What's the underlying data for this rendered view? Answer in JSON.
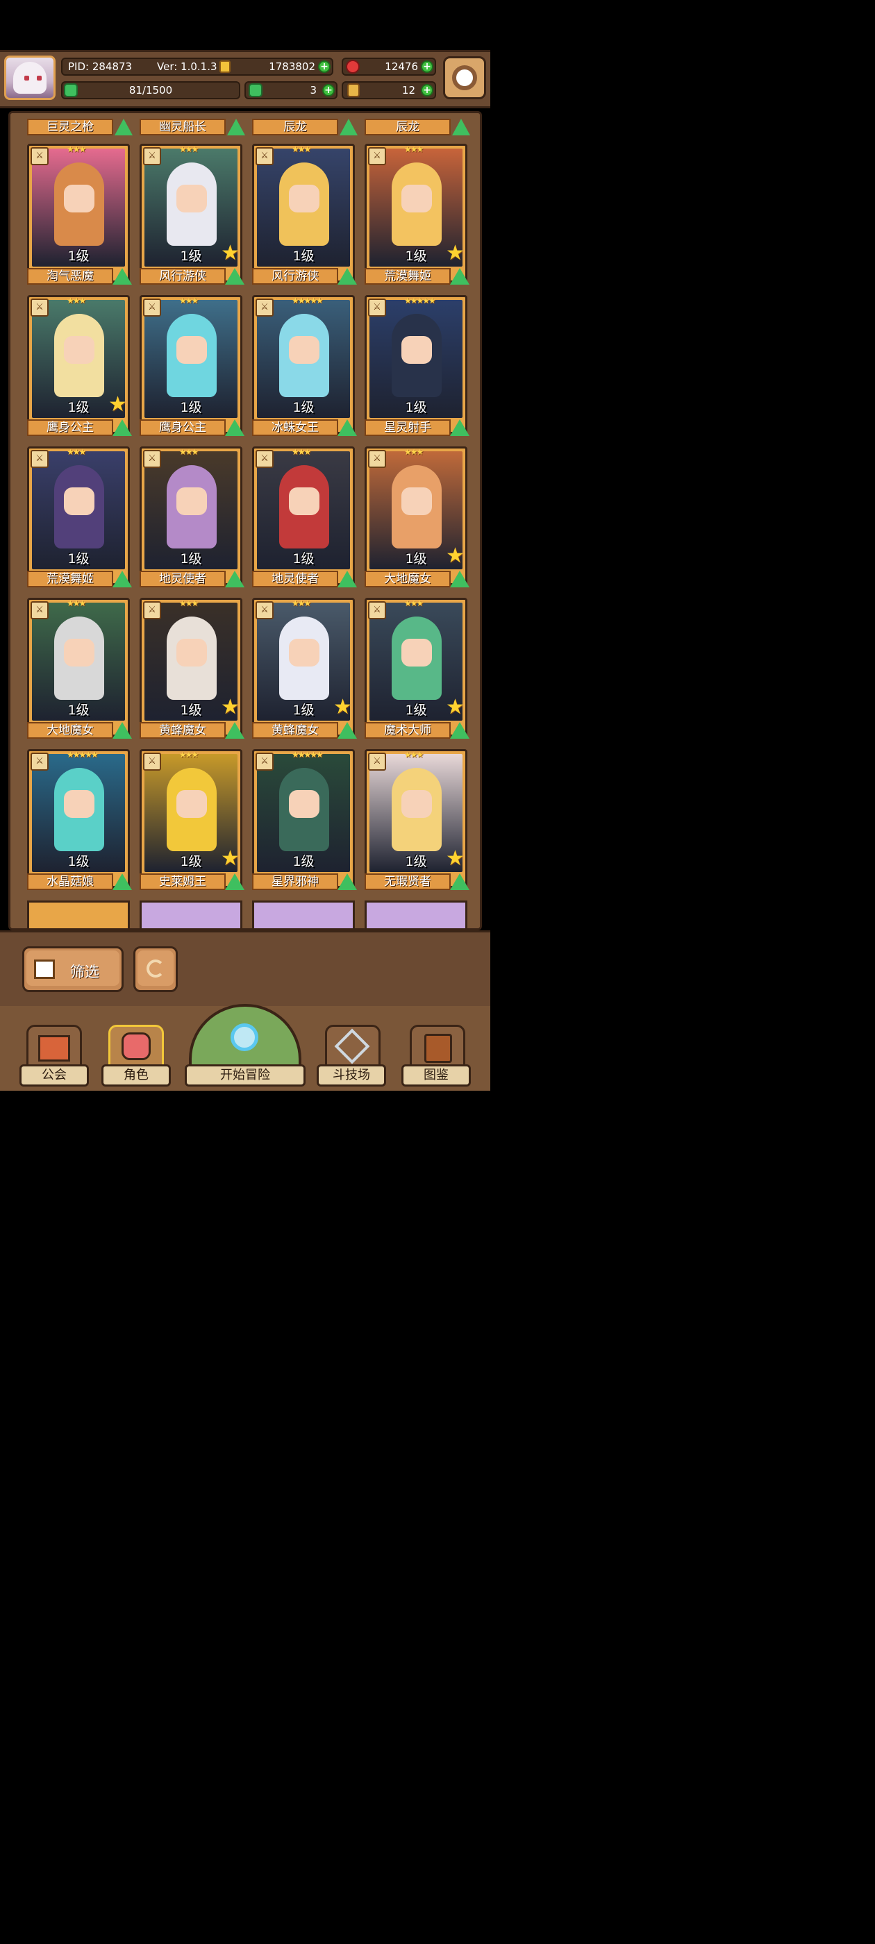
{
  "header": {
    "pid": "PID: 284873",
    "version": "Ver: 1.0.1.3",
    "gold": "1783802",
    "gems": "12476",
    "exp": "81/1500",
    "clover": "3",
    "ticket": "12"
  },
  "top_names": [
    "巨灵之枪",
    "幽灵船长",
    "辰龙",
    "辰龙"
  ],
  "cards": [
    {
      "name": "淘气恶魔",
      "level": "1级",
      "art": "#e56b8f",
      "hair": "#d98a4a",
      "stars": "★★★"
    },
    {
      "name": "风行游侠",
      "level": "1级",
      "art": "#4b7a6a",
      "hair": "#e8e8f0",
      "stars": "★★★"
    },
    {
      "name": "风行游侠",
      "level": "1级",
      "art": "#36446a",
      "hair": "#f0c25a",
      "stars": "★★★"
    },
    {
      "name": "荒漠舞姬",
      "level": "1级",
      "art": "#c8643a",
      "hair": "#f3c360",
      "stars": "★★★"
    },
    {
      "name": "鹰身公主",
      "level": "1级",
      "art": "#4a7a6a",
      "hair": "#f2dfa0",
      "stars": "★★★"
    },
    {
      "name": "鹰身公主",
      "level": "1级",
      "art": "#3f6f8a",
      "hair": "#6fd6e0",
      "stars": "★★★"
    },
    {
      "name": "冰蛛女王",
      "level": "1级",
      "art": "#3a5f7a",
      "hair": "#8ad9e8",
      "stars": "★★★★★"
    },
    {
      "name": "星灵射手",
      "level": "1级",
      "art": "#2c3f6a",
      "hair": "#28324a",
      "stars": "★★★★★"
    },
    {
      "name": "荒漠舞姬",
      "level": "1级",
      "art": "#3a3f6a",
      "hair": "#52407a",
      "stars": "★★★"
    },
    {
      "name": "地灵使者",
      "level": "1级",
      "art": "#4a3a2a",
      "hair": "#b48ac8",
      "stars": "★★★"
    },
    {
      "name": "地灵使者",
      "level": "1级",
      "art": "#3a3a44",
      "hair": "#c23a3a",
      "stars": "★★★"
    },
    {
      "name": "大地魔女",
      "level": "1级",
      "art": "#c06a3a",
      "hair": "#e8a068",
      "stars": "★★★"
    },
    {
      "name": "大地魔女",
      "level": "1级",
      "art": "#3f6a4a",
      "hair": "#d8d8d8",
      "stars": "★★★"
    },
    {
      "name": "黄蜂魔女",
      "level": "1级",
      "art": "#3a3028",
      "hair": "#e8e0d8",
      "stars": "★★★"
    },
    {
      "name": "黄蜂魔女",
      "level": "1级",
      "art": "#4a5a6a",
      "hair": "#e8eaf4",
      "stars": "★★★"
    },
    {
      "name": "魔术大师",
      "level": "1级",
      "art": "#3a4a5a",
      "hair": "#58b888",
      "stars": "★★★"
    },
    {
      "name": "水晶菇娘",
      "level": "1级",
      "art": "#2a6a8a",
      "hair": "#5ad0c8",
      "stars": "★★★★★"
    },
    {
      "name": "史莱姆王",
      "level": "1级",
      "art": "#c89a2a",
      "hair": "#f2c83a",
      "stars": "★★★"
    },
    {
      "name": "星界邪神",
      "level": "1级",
      "art": "#2a4a3a",
      "hair": "#3a6a5a",
      "stars": "★★★★★"
    },
    {
      "name": "无瑕贤者",
      "level": "1级",
      "art": "#e8d8d8",
      "hair": "#f4d27a",
      "stars": "★★★"
    }
  ],
  "filter_label": "筛选",
  "nav": [
    "公会",
    "角色",
    "开始冒险",
    "斗技场",
    "图鉴"
  ]
}
